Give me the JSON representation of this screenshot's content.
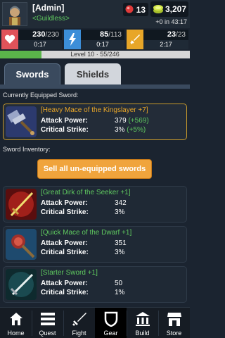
{
  "player": {
    "name": "[Admin]",
    "guild": "<Guildless>"
  },
  "currency": {
    "gems": "13",
    "gold": "3,207",
    "gold_rate": "+0 in 43:17"
  },
  "stats": {
    "health": {
      "value": "230",
      "max": "/230",
      "timer": "0:17",
      "color": "#e0535a",
      "icon": "heart-icon"
    },
    "energy": {
      "value": "85",
      "max": "/113",
      "timer": "0:17",
      "color": "#3c8ed8",
      "icon": "lightning-icon"
    },
    "stamina": {
      "value": "23",
      "max": "/23",
      "timer": "2:17",
      "color": "#e8a628",
      "icon": "sword-icon"
    }
  },
  "xp": {
    "text": "Level 10 · 55/246",
    "progress": 0.22
  },
  "tabs": {
    "swords": "Swords",
    "shields": "Shields"
  },
  "sections": {
    "equipped": "Currently Equipped Sword:",
    "inventory": "Sword Inventory:"
  },
  "labels": {
    "attack": "Attack Power:",
    "crit": "Critical Strike:"
  },
  "equipped": {
    "name": "[Heavy Mace of the Kingslayer +7]",
    "attack": "379",
    "attack_bonus": "(+569)",
    "crit": "3%",
    "crit_bonus": "(+5%)"
  },
  "sell_button": "Sell all un-equipped swords",
  "inventory": [
    {
      "name": "[Great Dirk of the Seeker +1]",
      "attack": "342",
      "crit": "3%"
    },
    {
      "name": "[Quick Mace of the Dwarf +1]",
      "attack": "351",
      "crit": "3%"
    },
    {
      "name": "[Starter Sword +1]",
      "attack": "50",
      "crit": "1%"
    }
  ],
  "nav": [
    "Home",
    "Quest",
    "Fight",
    "Gear",
    "Build",
    "Store"
  ],
  "nav_active": "Gear"
}
